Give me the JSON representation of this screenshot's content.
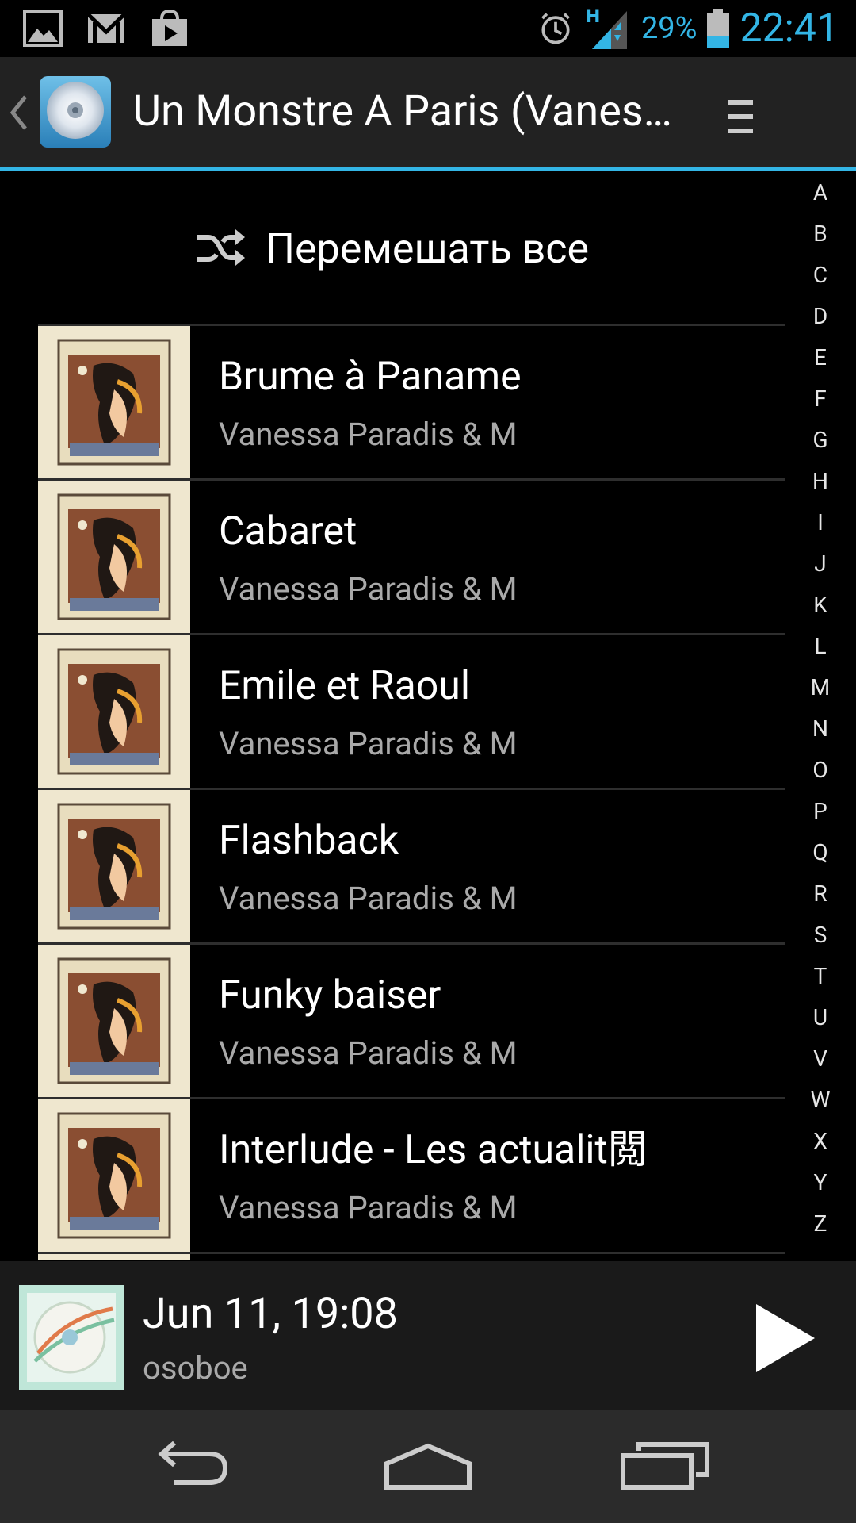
{
  "status_bar": {
    "time": "22:41",
    "battery_percent": "29%",
    "network_type": "H",
    "left_icons": [
      "image-icon",
      "gmail-icon",
      "store-bag-icon"
    ],
    "right_icons": [
      "alarm-icon",
      "signal-icon",
      "battery-icon"
    ],
    "accent_color": "#33b5e5"
  },
  "action_bar": {
    "title": "Un Monstre A Paris (Vanes…",
    "up_icon": "chevron-left-icon",
    "app_icon": "cd-disc-icon",
    "menu_icon": "overflow-menu-icon",
    "accent_color": "#33b5e5"
  },
  "shuffle": {
    "icon": "shuffle-icon",
    "label": "Перемешать все"
  },
  "tracks": [
    {
      "title": "Brume à Paname",
      "artist": "Vanessa Paradis & M"
    },
    {
      "title": "Cabaret",
      "artist": "Vanessa Paradis & M"
    },
    {
      "title": "Emile et Raoul",
      "artist": "Vanessa Paradis & M"
    },
    {
      "title": "Flashback",
      "artist": "Vanessa Paradis & M"
    },
    {
      "title": "Funky baiser",
      "artist": "Vanessa Paradis & M"
    },
    {
      "title": "Interlude - Les actualit閲",
      "artist": "Vanessa Paradis & M"
    }
  ],
  "alphabet_index": [
    "A",
    "B",
    "C",
    "D",
    "E",
    "F",
    "G",
    "H",
    "I",
    "J",
    "K",
    "L",
    "M",
    "N",
    "O",
    "P",
    "Q",
    "R",
    "S",
    "T",
    "U",
    "V",
    "W",
    "X",
    "Y",
    "Z"
  ],
  "now_playing": {
    "title": "Jun 11, 19:08",
    "subtitle": "osoboe",
    "play_icon": "play-icon"
  },
  "nav_bar": {
    "icons": [
      "back-icon",
      "home-icon",
      "recent-apps-icon"
    ]
  }
}
